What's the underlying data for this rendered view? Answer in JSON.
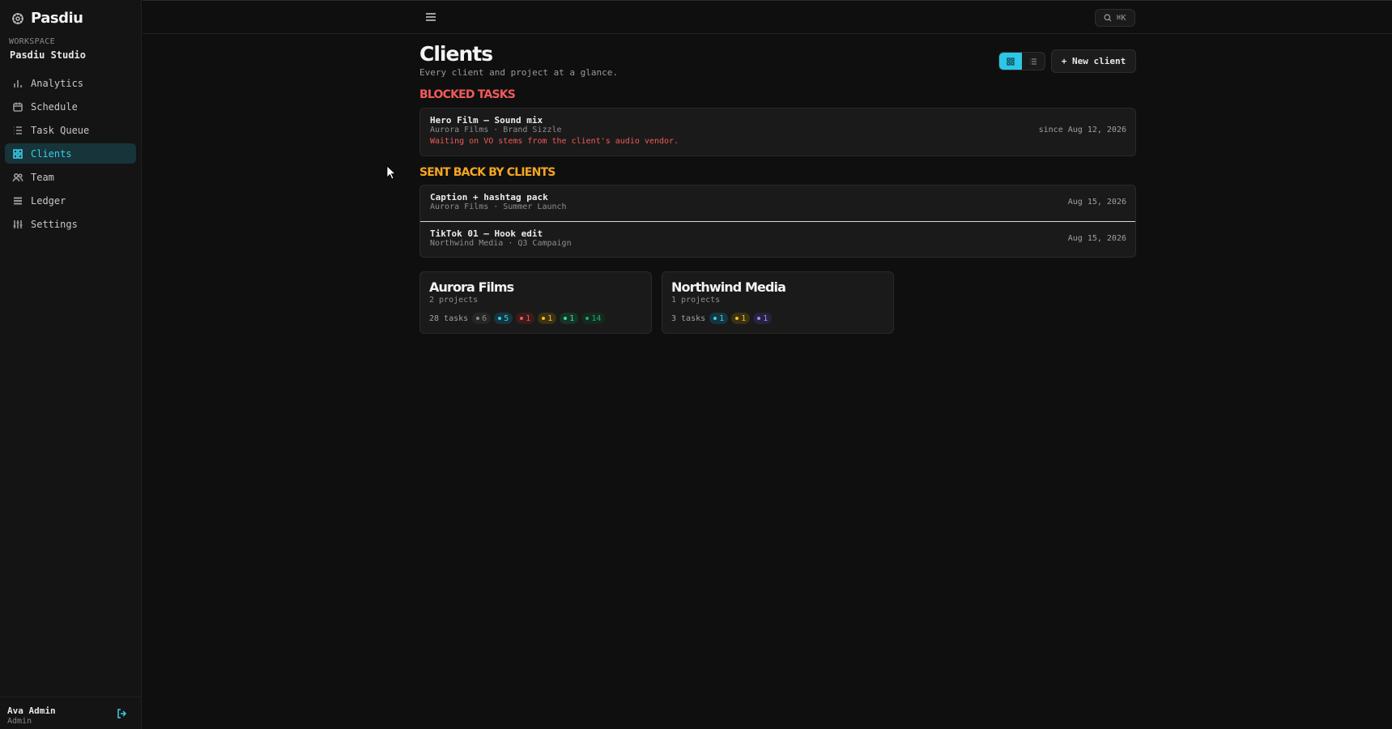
{
  "brand": {
    "name": "Pasdiu"
  },
  "workspace": {
    "label": "WORKSPACE",
    "name": "Pasdiu Studio"
  },
  "nav": [
    {
      "label": "Analytics",
      "icon": "bar-chart-icon",
      "active": false
    },
    {
      "label": "Schedule",
      "icon": "calendar-icon",
      "active": false
    },
    {
      "label": "Task Queue",
      "icon": "list-icon",
      "active": false
    },
    {
      "label": "Clients",
      "icon": "grid-icon",
      "active": true
    },
    {
      "label": "Team",
      "icon": "users-icon",
      "active": false
    },
    {
      "label": "Ledger",
      "icon": "ledger-icon",
      "active": false
    },
    {
      "label": "Settings",
      "icon": "sliders-icon",
      "active": false
    }
  ],
  "user": {
    "name": "Ava Admin",
    "role": "Admin"
  },
  "topbar": {
    "search_shortcut": "⌘K"
  },
  "page": {
    "title": "Clients",
    "subtitle": "Every client and project at a glance.",
    "new_button": "+ New client"
  },
  "blocked": {
    "title": "BLOCKED TASKS",
    "items": [
      {
        "title": "Hero Film — Sound mix",
        "meta": "Aurora Films · Brand Sizzle",
        "note": "Waiting on VO stems from the client's audio vendor.",
        "date": "since Aug 12, 2026"
      }
    ]
  },
  "sent_back": {
    "title": "SENT BACK BY CLIENTS",
    "items": [
      {
        "title": "Caption + hashtag pack",
        "meta": "Aurora Films · Summer Launch",
        "date": "Aug 15, 2026"
      },
      {
        "title": "TikTok 01 — Hook edit",
        "meta": "Northwind Media · Q3 Campaign",
        "date": "Aug 15, 2026"
      }
    ]
  },
  "clients": [
    {
      "name": "Aurora Films",
      "projects": "2 projects",
      "tasks": "28 tasks",
      "pills": [
        {
          "count": "6",
          "color": "#8a8a8a",
          "bg": "#262626"
        },
        {
          "count": "5",
          "color": "#3ccde8",
          "bg": "#153640"
        },
        {
          "count": "1",
          "color": "#f05a5a",
          "bg": "#3d1b1b"
        },
        {
          "count": "1",
          "color": "#f5c023",
          "bg": "#3b3214"
        },
        {
          "count": "1",
          "color": "#3ddc97",
          "bg": "#163427"
        },
        {
          "count": "14",
          "color": "#2fa36b",
          "bg": "#132b1f"
        }
      ]
    },
    {
      "name": "Northwind Media",
      "projects": "1 projects",
      "tasks": "3 tasks",
      "pills": [
        {
          "count": "1",
          "color": "#3ccde8",
          "bg": "#153640"
        },
        {
          "count": "1",
          "color": "#f5c023",
          "bg": "#3b3214"
        },
        {
          "count": "1",
          "color": "#9d8cf5",
          "bg": "#27223f"
        }
      ]
    }
  ]
}
